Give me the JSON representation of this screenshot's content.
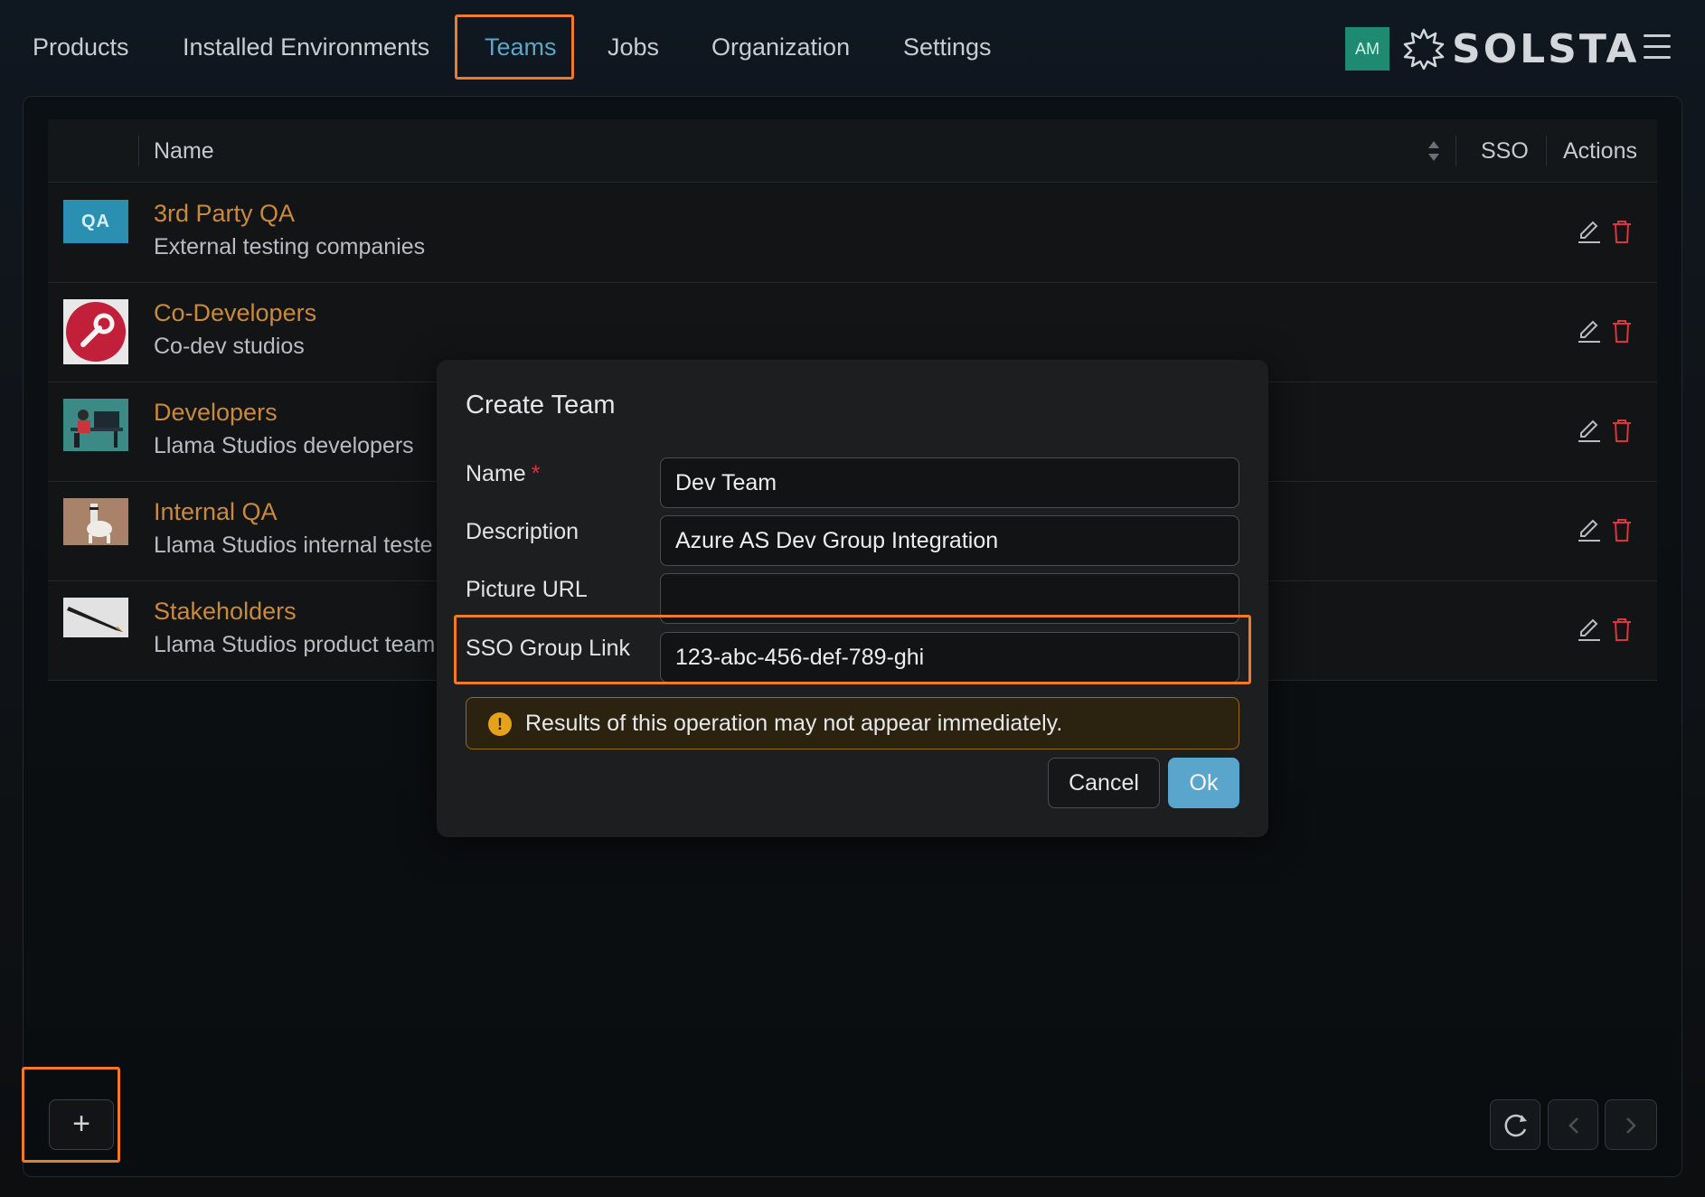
{
  "nav": {
    "items": [
      {
        "label": "Products"
      },
      {
        "label": "Installed Environments"
      },
      {
        "label": "Teams"
      },
      {
        "label": "Jobs"
      },
      {
        "label": "Organization"
      },
      {
        "label": "Settings"
      }
    ],
    "active": "Teams",
    "avatar_initials": "AM",
    "logo_text": "SOLSTA"
  },
  "table": {
    "headers": {
      "name": "Name",
      "sso": "SSO",
      "actions": "Actions"
    },
    "rows": [
      {
        "name": "3rd Party QA",
        "description": "External testing companies",
        "thumb": "qa-logo"
      },
      {
        "name": "Co-Developers",
        "description": "Co-dev studios",
        "thumb": "wrench-logo"
      },
      {
        "name": "Developers",
        "description": "Llama Studios developers",
        "thumb": "developer-illustration"
      },
      {
        "name": "Internal QA",
        "description": "Llama Studios internal teste",
        "thumb": "llama-photo"
      },
      {
        "name": "Stakeholders",
        "description": "Llama Studios product team",
        "thumb": "pen-photo"
      }
    ],
    "qa_thumb_text": "QA"
  },
  "modal": {
    "title": "Create Team",
    "fields": {
      "name": {
        "label": "Name",
        "required_mark": "*",
        "value": "Dev Team"
      },
      "description": {
        "label": "Description",
        "value": "Azure AS Dev Group Integration"
      },
      "picture_url": {
        "label": "Picture URL",
        "value": ""
      },
      "sso_group_link": {
        "label": "SSO Group Link",
        "value": "123-abc-456-def-789-ghi"
      }
    },
    "alert": {
      "icon": "!",
      "text": "Results of this operation may not appear immediately."
    },
    "cancel_label": "Cancel",
    "ok_label": "Ok"
  },
  "bottom": {
    "add_label": "+"
  },
  "colors": {
    "accent": "#5ba7c9",
    "team_name": "#c98a3c",
    "focus_outline": "#f07a2a",
    "delete": "#d9363e",
    "warning": "#e6a21c"
  }
}
